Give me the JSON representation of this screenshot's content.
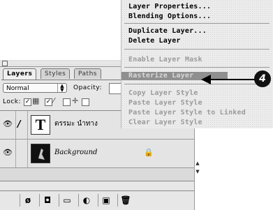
{
  "context_menu": {
    "items": [
      {
        "label": "Layer Properties...",
        "enabled": true
      },
      {
        "label": "Blending Options...",
        "enabled": true
      },
      {
        "label": "Duplicate Layer...",
        "enabled": true
      },
      {
        "label": "Delete Layer",
        "enabled": true
      },
      {
        "label": "Enable Layer Mask",
        "enabled": false
      },
      {
        "label": "Rasterize Layer",
        "enabled": true,
        "highlighted": true
      },
      {
        "label": "Copy Layer Style",
        "enabled": false
      },
      {
        "label": "Paste Layer Style",
        "enabled": false
      },
      {
        "label": "Paste Layer Style to Linked",
        "enabled": false
      },
      {
        "label": "Clear Layer Style",
        "enabled": false
      }
    ],
    "highlight_color": "#8f8f8f"
  },
  "callout": {
    "number": "4"
  },
  "palette": {
    "tabs": [
      {
        "label": "Layers",
        "active": true
      },
      {
        "label": "Styles",
        "active": false
      },
      {
        "label": "Paths",
        "active": false
      }
    ],
    "blend_mode": "Normal",
    "opacity_label": "Opacity:",
    "lock_label": "Lock:",
    "layers": [
      {
        "name": "ตรรมะ นำทาง",
        "type": "text",
        "thumb_glyph": "T",
        "visible": true,
        "active": true
      },
      {
        "name": "Background",
        "type": "image",
        "visible": true,
        "locked": true
      }
    ]
  }
}
